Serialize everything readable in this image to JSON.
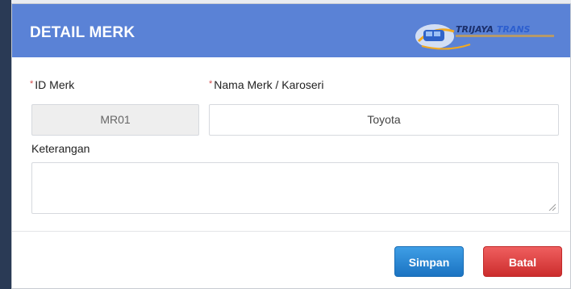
{
  "modal": {
    "title": "DETAIL MERK",
    "logo": {
      "text_primary": "TRIJAYA",
      "text_secondary": "TRANS"
    }
  },
  "form": {
    "id_merk": {
      "label": "ID Merk",
      "required_marker": "*",
      "value": "MR01"
    },
    "nama_merk": {
      "label": "Nama Merk / Karoseri",
      "required_marker": "*",
      "value": "Toyota"
    },
    "keterangan": {
      "label": "Keterangan",
      "value": ""
    }
  },
  "buttons": {
    "save_label": "Simpan",
    "cancel_label": "Batal"
  },
  "colors": {
    "header": "#5a82d6",
    "save": "#1f7dcc",
    "cancel": "#dd3b3b",
    "required": "#d24b4b"
  }
}
